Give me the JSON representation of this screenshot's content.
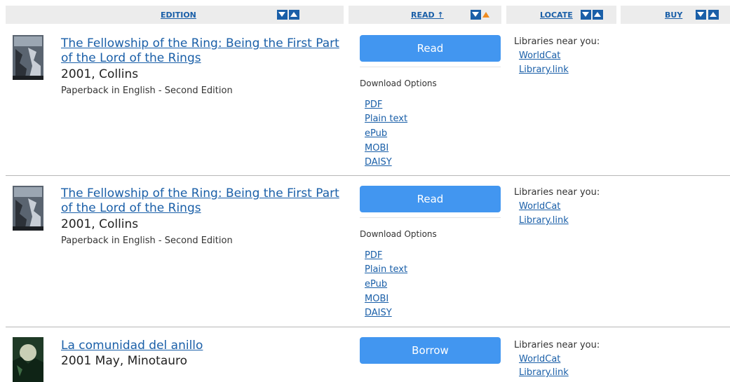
{
  "header": {
    "edition_label": "EDITION",
    "read_label": "READ ↑",
    "locate_label": "LOCATE",
    "buy_label": "BUY"
  },
  "rows": [
    {
      "title": "The Fellowship of the Ring: Being the First Part of the Lord of the Rings",
      "published": "2001, Collins",
      "format": "Paperback in English - Second Edition",
      "action_label": "Read",
      "download_heading": "Download Options",
      "downloads": [
        "PDF",
        "Plain text",
        "ePub",
        "MOBI",
        "DAISY"
      ],
      "libraries_heading": "Libraries near you:",
      "libraries": [
        "WorldCat",
        "Library.link"
      ]
    },
    {
      "title": "The Fellowship of the Ring: Being the First Part of the Lord of the Rings",
      "published": "2001, Collins",
      "format": "Paperback in English - Second Edition",
      "action_label": "Read",
      "download_heading": "Download Options",
      "downloads": [
        "PDF",
        "Plain text",
        "ePub",
        "MOBI",
        "DAISY"
      ],
      "libraries_heading": "Libraries near you:",
      "libraries": [
        "WorldCat",
        "Library.link"
      ]
    },
    {
      "title": "La comunidad del anillo",
      "published": "2001 May, Minotauro",
      "action_label": "Borrow",
      "libraries_heading": "Libraries near you:",
      "libraries": [
        "WorldCat",
        "Library.link"
      ]
    }
  ],
  "colors": {
    "accent": "#4296f0",
    "link": "#1a5fa8",
    "sort_active": "#f08b1f",
    "header_bg": "#ececec"
  },
  "icons": [
    "sort-descending-icon",
    "sort-ascending-icon",
    "book-cover-image"
  ]
}
